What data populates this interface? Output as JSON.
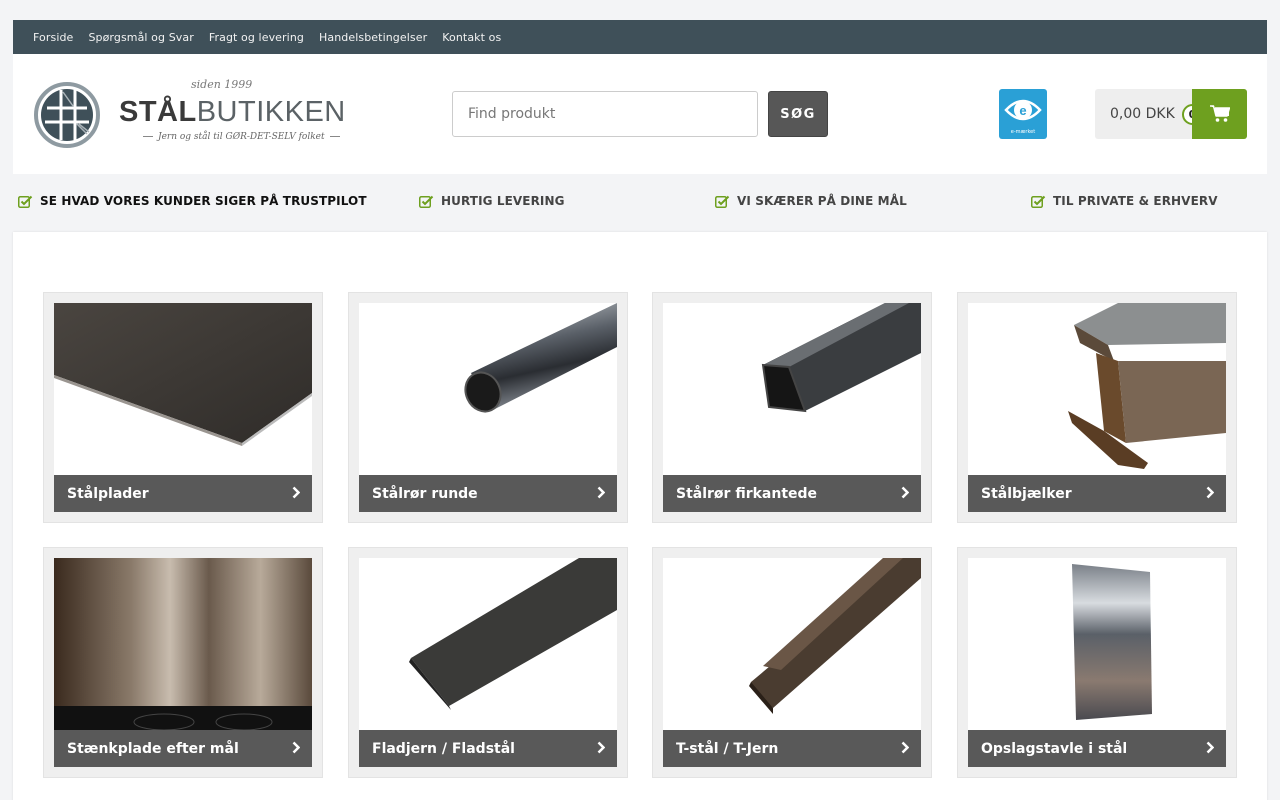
{
  "topnav": {
    "items": [
      "Forside",
      "Spørgsmål og Svar",
      "Fragt og levering",
      "Handelsbetingelser",
      "Kontakt os"
    ]
  },
  "logo": {
    "since": "siden 1999",
    "brand_bold": "STÅL",
    "brand_light": "BUTIKKEN",
    "tagline": "Jern og stål til GØR-DET-SELV folket"
  },
  "search": {
    "placeholder": "Find produkt",
    "button_label": "SØG"
  },
  "emarket": {
    "label": "e-mærket"
  },
  "cart": {
    "amount": "0,00 DKK",
    "count": "0"
  },
  "usps": [
    "SE HVAD VORES KUNDER SIGER PÅ TRUSTPILOT",
    "HURTIG LEVERING",
    "VI SKÆRER PÅ DINE MÅL",
    "TIL PRIVATE & ERHVERV"
  ],
  "products": [
    {
      "name": "Stålplader",
      "icon": "steel-plate-image"
    },
    {
      "name": "Stålrør runde",
      "icon": "round-tube-image"
    },
    {
      "name": "Stålrør firkantede",
      "icon": "square-tube-image"
    },
    {
      "name": "Stålbjælker",
      "icon": "i-beam-image"
    },
    {
      "name": "Stænkplade efter mål",
      "icon": "splashback-image"
    },
    {
      "name": "Fladjern / Fladstål",
      "icon": "flat-bar-image"
    },
    {
      "name": "T-stål / T-Jern",
      "icon": "t-bar-image"
    },
    {
      "name": "Opslagstavle i stål",
      "icon": "notice-board-image"
    }
  ],
  "colors": {
    "topnav_bg": "#3f5059",
    "accent_green": "#6ea01f",
    "card_bar": "#595959",
    "emarket_blue": "#2aa0d6"
  }
}
